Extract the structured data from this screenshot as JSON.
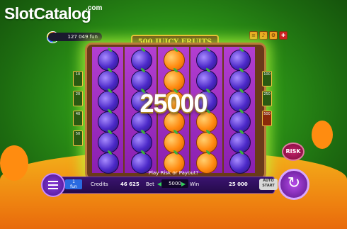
{
  "logo": {
    "text": "SlotCatalog",
    "suffix": ".com"
  },
  "balance": {
    "value": "127 049 fun"
  },
  "game_title": "500 JUICY FRUITS",
  "top_icons": [
    "menu-icon",
    "sound-icon",
    "settings-icon",
    "flag-icon"
  ],
  "reels": [
    [
      "plum",
      "plum",
      "plum",
      "plum",
      "plum",
      "plum"
    ],
    [
      "plum",
      "plum",
      "plum",
      "plum",
      "plum",
      "plum"
    ],
    [
      "orange",
      "orange",
      "orange",
      "orange",
      "orange",
      "orange"
    ],
    [
      "plum",
      "plum",
      "plum",
      "orange",
      "orange",
      "orange"
    ],
    [
      "plum",
      "plum",
      "plum",
      "plum",
      "plum",
      "plum"
    ]
  ],
  "win_overlay": "25000",
  "side_left": [
    "10",
    "20",
    "40",
    "50"
  ],
  "side_right": [
    "100",
    "250",
    "500"
  ],
  "risk_label": "RISK",
  "message": "Play Risk or Payout?",
  "bar": {
    "lines_value": "1",
    "lines_unit": "fun",
    "credits_label": "Credits",
    "credits_value": "46 625",
    "bet_label": "Bet",
    "bet_value": "5000",
    "win_label": "Win",
    "win_value": "25 000",
    "auto_label": "AUTO START"
  },
  "spin_icon": "spin-icon"
}
